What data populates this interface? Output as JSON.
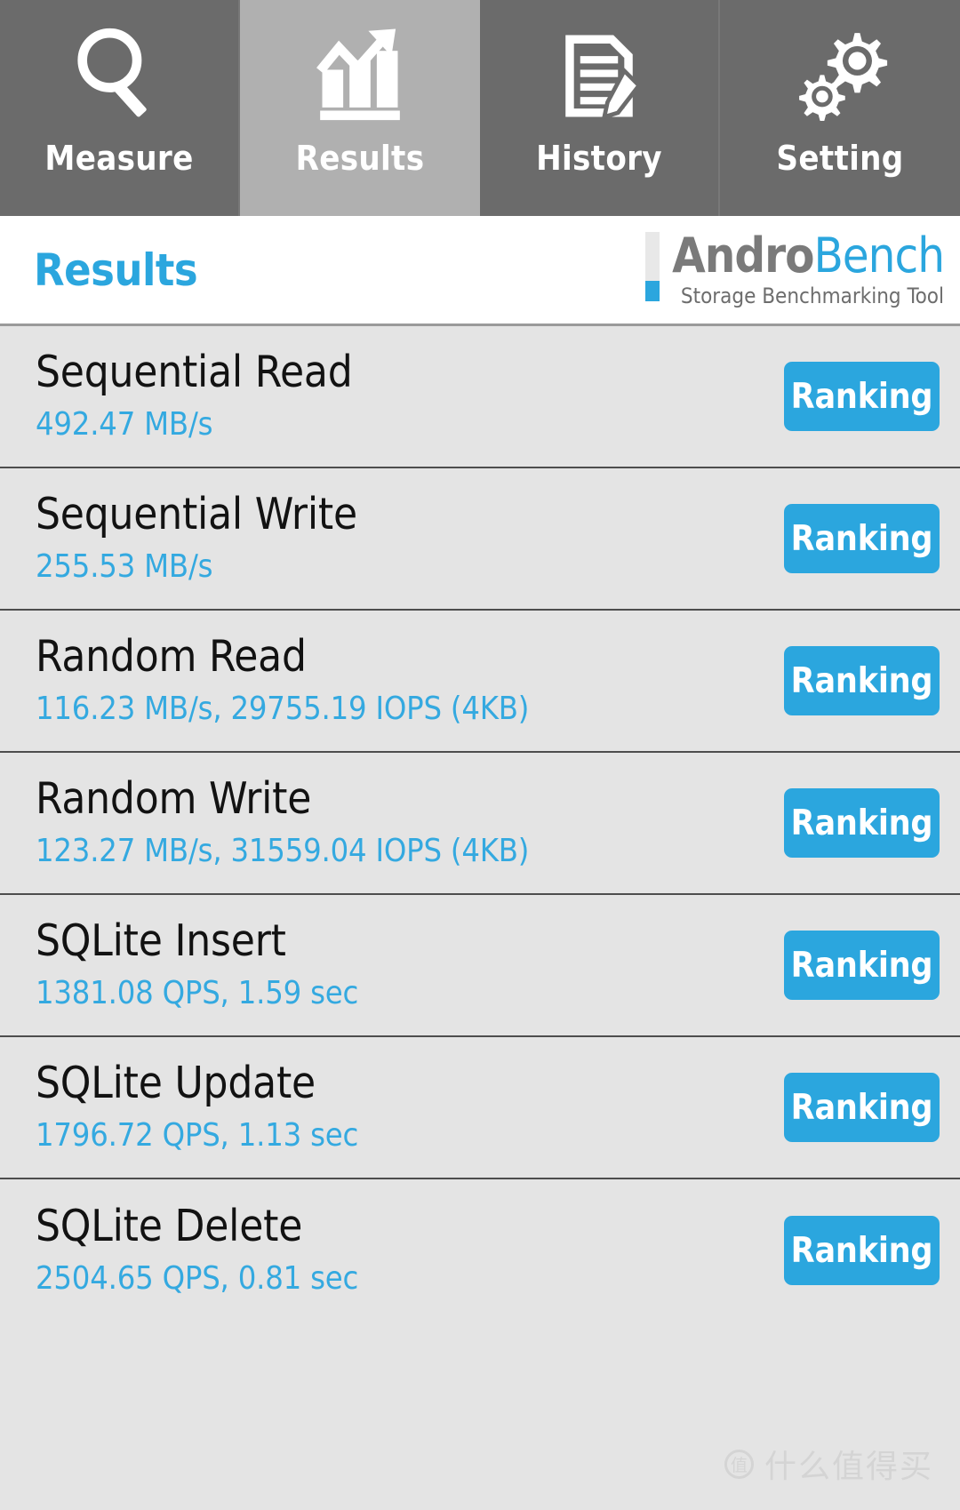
{
  "tabs": [
    {
      "label": "Measure",
      "icon": "magnifier-icon",
      "active": false
    },
    {
      "label": "Results",
      "icon": "bar-chart-trend-icon",
      "active": true
    },
    {
      "label": "History",
      "icon": "document-pencil-icon",
      "active": false
    },
    {
      "label": "Setting",
      "icon": "gears-icon",
      "active": false
    }
  ],
  "header": {
    "title": "Results",
    "brand_name_part1": "Andro",
    "brand_name_part2": "Bench",
    "brand_subtitle": "Storage Benchmarking Tool"
  },
  "colors": {
    "accent_blue": "#2ba6de",
    "value_blue": "#34a9e0",
    "tab_inactive": "#6b6b6b",
    "tab_active": "#b0b0b0",
    "row_bg": "#e4e4e4",
    "brand_gray": "#7a7a7a"
  },
  "results": [
    {
      "name": "Sequential Read",
      "value": "492.47 MB/s",
      "ranking_label": "Ranking"
    },
    {
      "name": "Sequential Write",
      "value": "255.53 MB/s",
      "ranking_label": "Ranking"
    },
    {
      "name": "Random Read",
      "value": "116.23 MB/s, 29755.19 IOPS (4KB)",
      "ranking_label": "Ranking"
    },
    {
      "name": "Random Write",
      "value": "123.27 MB/s, 31559.04 IOPS (4KB)",
      "ranking_label": "Ranking"
    },
    {
      "name": "SQLite Insert",
      "value": "1381.08 QPS, 1.59 sec",
      "ranking_label": "Ranking"
    },
    {
      "name": "SQLite Update",
      "value": "1796.72 QPS, 1.13 sec",
      "ranking_label": "Ranking"
    },
    {
      "name": "SQLite Delete",
      "value": "2504.65 QPS, 0.81 sec",
      "ranking_label": "Ranking"
    }
  ],
  "watermark": {
    "logo_glyph": "值",
    "text": "什么值得买"
  }
}
